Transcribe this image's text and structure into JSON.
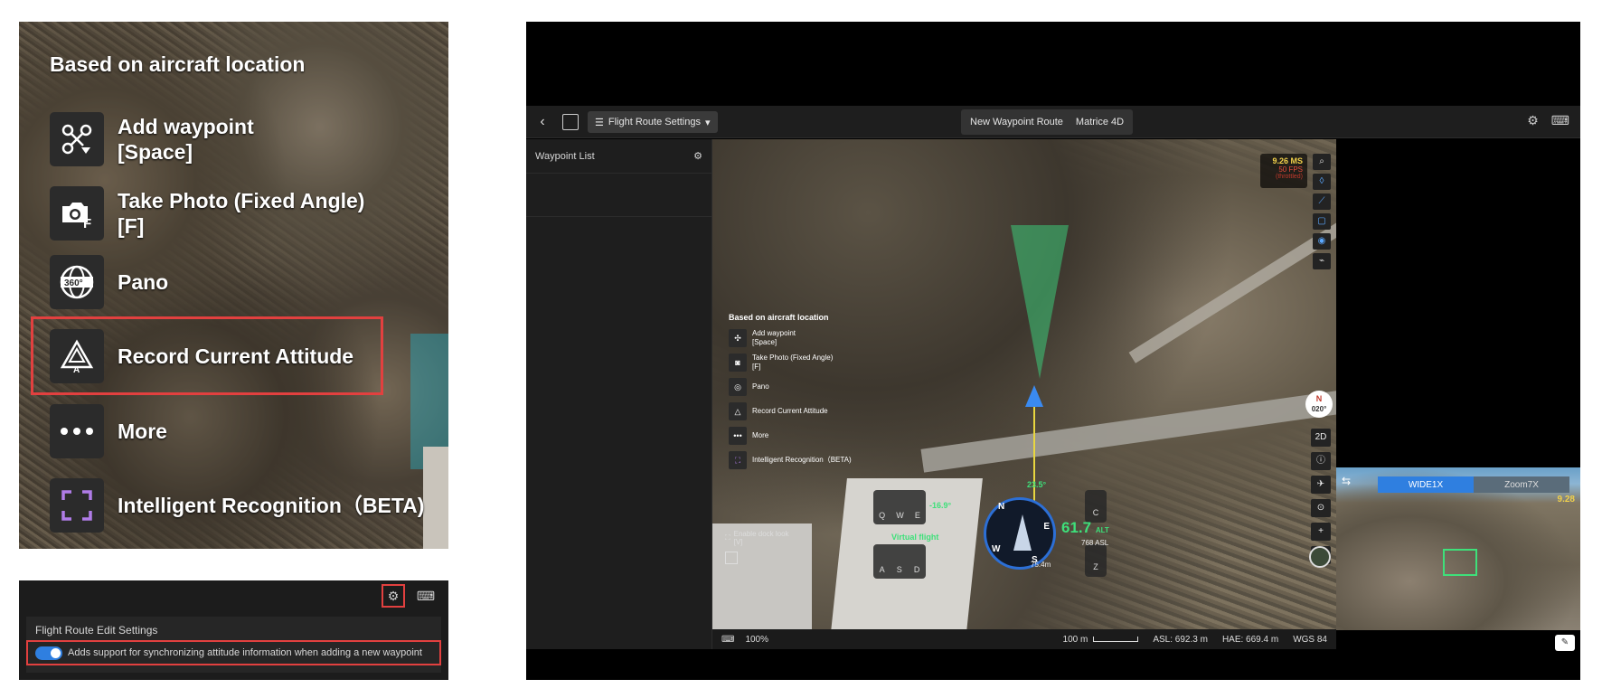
{
  "zoom_menu": {
    "title": "Based on aircraft location",
    "items": [
      {
        "label": "Add waypoint\n[Space]",
        "icon": "waypoint-drone-icon"
      },
      {
        "label": "Take Photo (Fixed Angle)\n[F]",
        "icon": "camera-fixed-icon"
      },
      {
        "label": "Pano",
        "icon": "pano-360-icon"
      },
      {
        "label": "Record Current Attitude",
        "icon": "attitude-icon",
        "highlighted": true
      },
      {
        "label": "More",
        "icon": "more-icon"
      },
      {
        "label": "Intelligent Recognition（BETA)",
        "icon": "recognition-icon"
      }
    ],
    "highlight_color": "#e2403f"
  },
  "settings_snippet": {
    "title": "Flight Route Edit Settings",
    "toggle_text": "Adds support for synchronizing attitude information when adding a new waypoint",
    "toggle_on": true
  },
  "app": {
    "topbar": {
      "route_settings": "Flight Route Settings",
      "route_name": "New Waypoint Route",
      "aircraft": "Matrice 4D"
    },
    "sidebar": {
      "waypoint_list": "Waypoint List"
    },
    "context_menu": {
      "title": "Based on aircraft location",
      "items": [
        {
          "label": "Add waypoint\n[Space]"
        },
        {
          "label": "Take Photo (Fixed Angle)\n[F]"
        },
        {
          "label": "Pano"
        },
        {
          "label": "Record Current Attitude"
        },
        {
          "label": "More"
        },
        {
          "label": "Intelligent Recognition（BETA)"
        }
      ]
    },
    "fps": {
      "ms": "9.26 MS",
      "fps": "50 FPS",
      "state": "(throttled)"
    },
    "compass": {
      "north": "N",
      "heading": "020°"
    },
    "view_mode": "2D",
    "hud": {
      "virtual_flight": "Virtual flight",
      "tilt": "-16.9°",
      "pitch": "23.5°",
      "altitude": "61.7",
      "altitude_unit": "ALT",
      "asl": "768 ASL",
      "distance": "75.4m",
      "keys_left_top": [
        "Q",
        "W",
        "E"
      ],
      "keys_left_bottom": [
        "A",
        "S",
        "D"
      ],
      "key_up": "C",
      "key_down": "Z",
      "compass_letters": [
        "N",
        "E",
        "S",
        "W"
      ]
    },
    "bottombar": {
      "zoom": "100%",
      "scale": "100 m",
      "asl": "ASL: 692.3 m",
      "hae": "HAE: 669.4 m",
      "datum": "WGS 84"
    },
    "camera": {
      "tab_wide": "WIDE1X",
      "tab_zoom": "Zoom7X",
      "fps": "9.28"
    },
    "dock_label": "Enable dock look\n[V]"
  }
}
